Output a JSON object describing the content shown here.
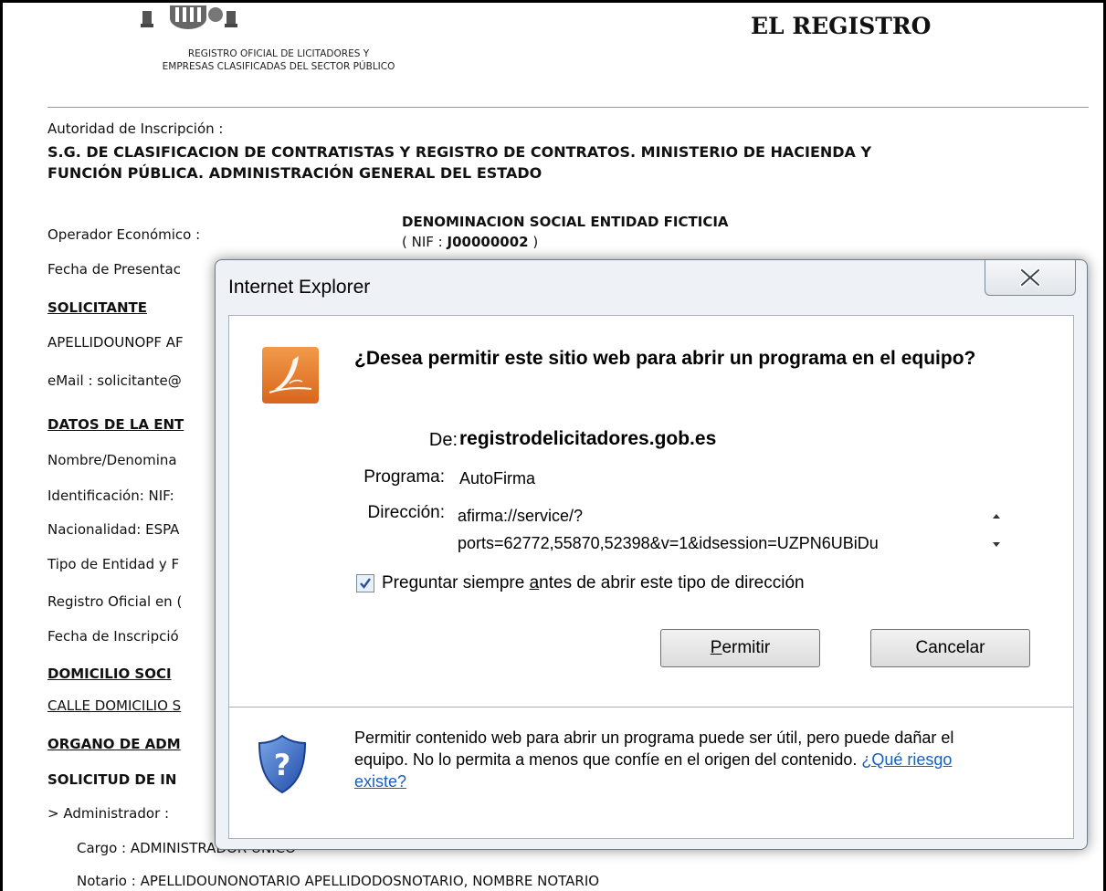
{
  "header": {
    "org_line1": "REGISTRO OFICIAL DE LICITADORES Y",
    "org_line2": "EMPRESAS CLASIFICADAS DEL SECTOR PÚBLICO",
    "title": "EL REGISTRO"
  },
  "document": {
    "autoridad_label": "Autoridad de Inscripción :",
    "autoridad_line1": "S.G. DE CLASIFICACION DE CONTRATISTAS Y REGISTRO DE CONTRATOS. MINISTERIO DE HACIENDA Y",
    "autoridad_line2": "FUNCIÓN PÚBLICA. ADMINISTRACIÓN GENERAL DEL ESTADO",
    "operador_label": "Operador Económico :",
    "operador_name": "DENOMINACION SOCIAL ENTIDAD FICTICIA",
    "nif_prefix": "( NIF : ",
    "nif_value": "J00000002",
    "nif_suffix": " )",
    "fecha_presentacion": "Fecha de Presentac",
    "solicitante_heading": "SOLICITANTE",
    "solicitante_name": "APELLIDOUNOPF AF",
    "email": "eMail : solicitante@",
    "datos_heading": "DATOS DE LA ENT",
    "nombre": "Nombre/Denomina",
    "identificacion": "Identificación: NIF:",
    "nacionalidad": "Nacionalidad: ESPA",
    "tipo_entidad": "Tipo de Entidad y F",
    "registro_oficial": "Registro Oficial en (",
    "fecha_inscripcion": "Fecha de Inscripció",
    "domicilio_heading": "DOMICILIO SOCI",
    "calle": "CALLE DOMICILIO S",
    "organo_heading": "ORGANO DE ADM",
    "solicitud_heading": "SOLICITUD DE IN",
    "administrador": ">  Administrador :",
    "cargo": "Cargo : ADMINISTRADOR ÚNICO",
    "notario": "Notario : APELLIDOUNONOTARIO APELLIDODOSNOTARIO, NOMBRE NOTARIO"
  },
  "dialog": {
    "title": "Internet Explorer",
    "question": "¿Desea permitir este sitio web para abrir un programa en el equipo?",
    "de_label": "De:",
    "de_value": "registrodelicitadores.gob.es",
    "programa_label": "Programa:",
    "programa_value": "AutoFirma",
    "direccion_label": "Dirección:",
    "direccion_line1": "afirma://service/?",
    "direccion_line2": "ports=62772,55870,52398&v=1&idsession=UZPN6UBiDu",
    "checkbox_checked": true,
    "checkbox_label_pre": "Preguntar siempre ",
    "checkbox_label_accel": "a",
    "checkbox_label_post": "ntes de abrir este tipo de dirección",
    "permitir_accel": "P",
    "permitir_rest": "ermitir",
    "cancelar_label": "Cancelar",
    "warning_text": "Permitir contenido web para abrir un programa puede ser útil, pero puede dañar el equipo. No lo permita a menos que confíe en el origen del contenido. ",
    "risk_link": "¿Qué riesgo existe?",
    "icons": [
      "autofirma-icon",
      "close-icon",
      "shield-question-icon",
      "checkbox-check-icon",
      "scroll-up-icon",
      "scroll-down-icon"
    ]
  }
}
